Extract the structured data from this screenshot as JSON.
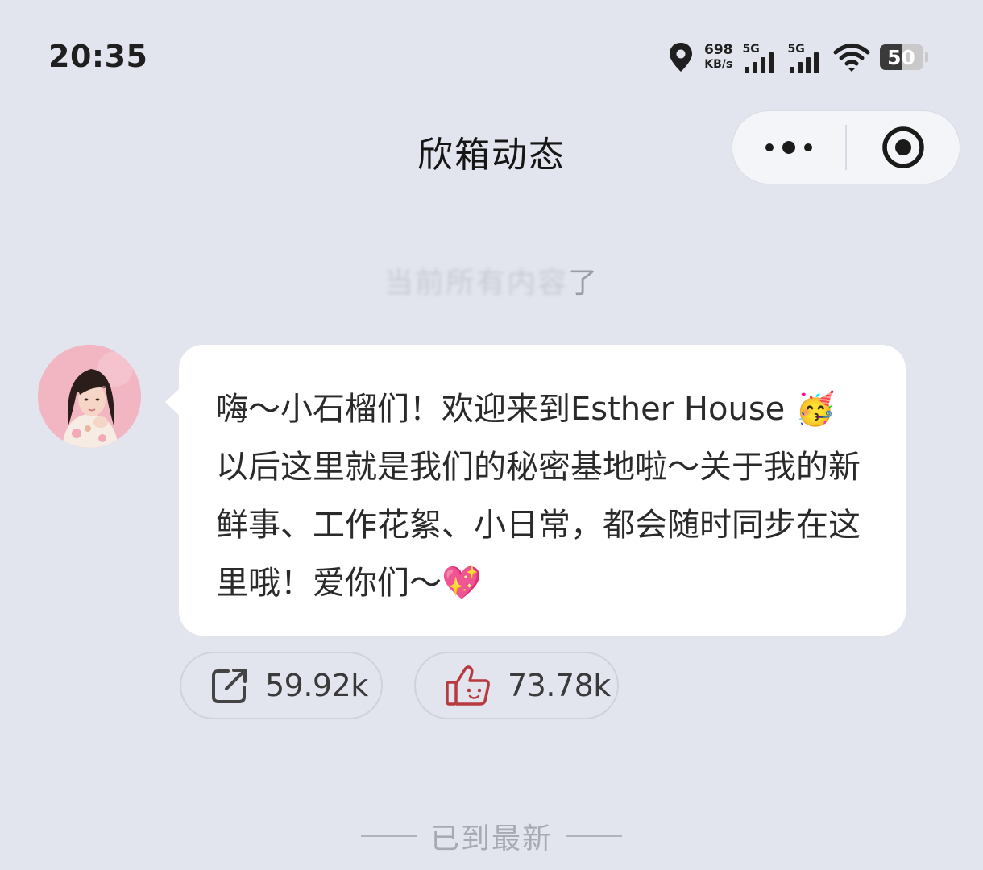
{
  "status_bar": {
    "time": "20:35",
    "net_speed_value": "698",
    "net_speed_unit": "KB/s",
    "signal_1_label": "5G",
    "signal_2_label": "5G",
    "battery_level": 50,
    "battery_text": "50",
    "icons": [
      "location-icon",
      "signal-icon",
      "wifi-icon",
      "battery-icon"
    ]
  },
  "nav": {
    "title": "欣箱动态",
    "more_icon": "more-dots-icon",
    "close_icon": "target-circle-icon"
  },
  "faded_text": {
    "ghost": "当前所有内容",
    "tail": "了"
  },
  "message": {
    "text": "嗨～小石榴们！欢迎来到Esther House 🥳 以后这里就是我们的秘密基地啦～关于我的新鲜事、工作花絮、小日常，都会随时同步在这里哦！爱你们～💖"
  },
  "actions": {
    "share_count": "59.92k",
    "like_count": "73.78k",
    "share_icon": "share-icon",
    "like_icon": "thumbs-up-icon"
  },
  "footer": {
    "end_text": "已到最新"
  },
  "colors": {
    "background": "#e2e5ee",
    "bubble": "#ffffff",
    "like_icon": "#b73a3f"
  }
}
